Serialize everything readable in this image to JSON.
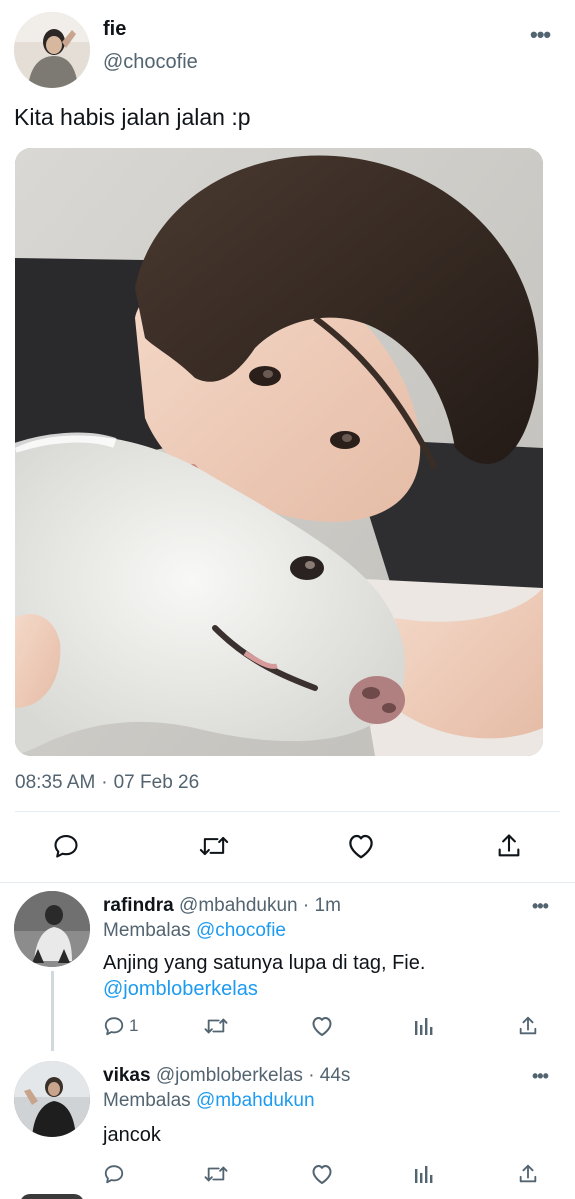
{
  "tweet": {
    "author_name": "fie",
    "author_handle": "@chocofie",
    "text": "Kita habis jalan jalan :p",
    "time": "08:35 AM",
    "separator": "·",
    "date": "07 Feb 26",
    "more": "•••"
  },
  "replies": [
    {
      "name": "rafindra",
      "handle": "@mbahdukun",
      "separator": "·",
      "time": "1m",
      "replying_label": "Membalas",
      "replying_to": "@chocofie",
      "text": "Anjing yang satunya lupa di tag, Fie.",
      "mention": "@jombloberkelas",
      "reply_count": "1",
      "more": "•••"
    },
    {
      "name": "vikas",
      "handle": "@jombloberkelas",
      "separator": "·",
      "time": "44s",
      "replying_label": "Membalas",
      "replying_to": "@mbahdukun",
      "text": "jancok",
      "more": "•••"
    }
  ],
  "colors": {
    "text_primary": "#0f1419",
    "text_secondary": "#536471",
    "link": "#1d9bf0",
    "divider": "#e6ecf0"
  },
  "icons": [
    "reply-icon",
    "retweet-icon",
    "like-icon",
    "share-icon",
    "analytics-icon",
    "more-icon"
  ]
}
